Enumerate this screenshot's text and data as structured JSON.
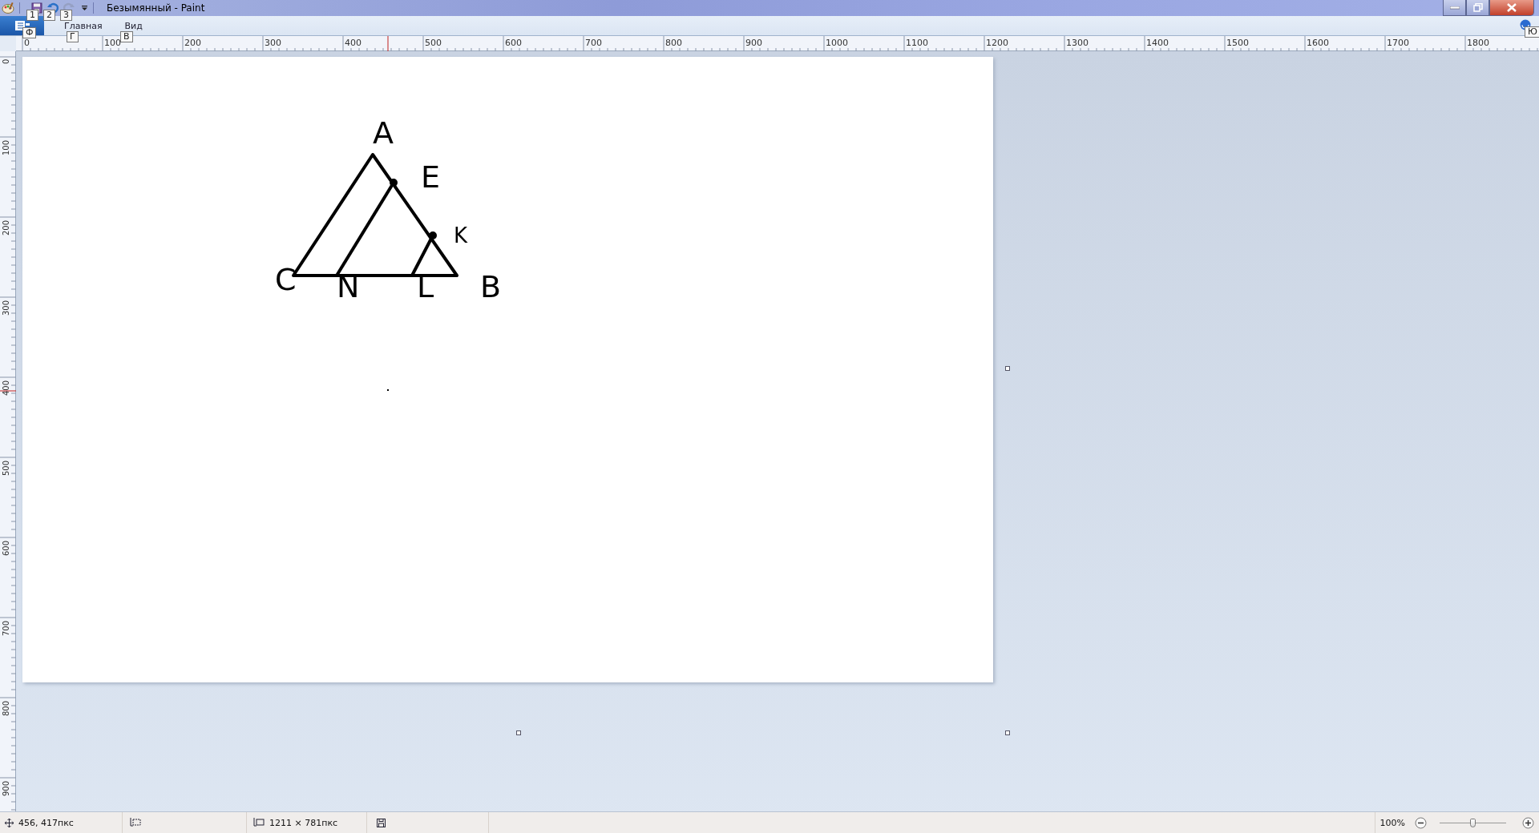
{
  "window": {
    "title": "Безымянный - Paint"
  },
  "quick_access_keytips": [
    "1",
    "2",
    "3"
  ],
  "file_menu": {
    "keytip": "Ф"
  },
  "tabs": [
    {
      "label": "Главная",
      "keytip": "Г",
      "selected": false
    },
    {
      "label": "Вид",
      "keytip": "В",
      "selected": false
    }
  ],
  "help_keytip": "Ю",
  "horizontal_ruler": {
    "labels": [
      "0",
      "100",
      "200",
      "300",
      "400",
      "500",
      "600",
      "700",
      "800",
      "900",
      "1000",
      "1100",
      "1200",
      "1300",
      "1400",
      "1500",
      "1600",
      "1700",
      "1800"
    ]
  },
  "vertical_ruler": {
    "labels": [
      "0",
      "100",
      "200",
      "300",
      "400",
      "500",
      "600",
      "700",
      "800",
      "900"
    ]
  },
  "canvas": {
    "labels": [
      "A",
      "E",
      "K",
      "C",
      "N",
      "L",
      "B"
    ]
  },
  "status_bar": {
    "cursor_position": "456, 417пкс",
    "image_size": "1211 × 781пкс",
    "zoom": "100%",
    "zoom_slider": {
      "level": 0.5
    }
  }
}
